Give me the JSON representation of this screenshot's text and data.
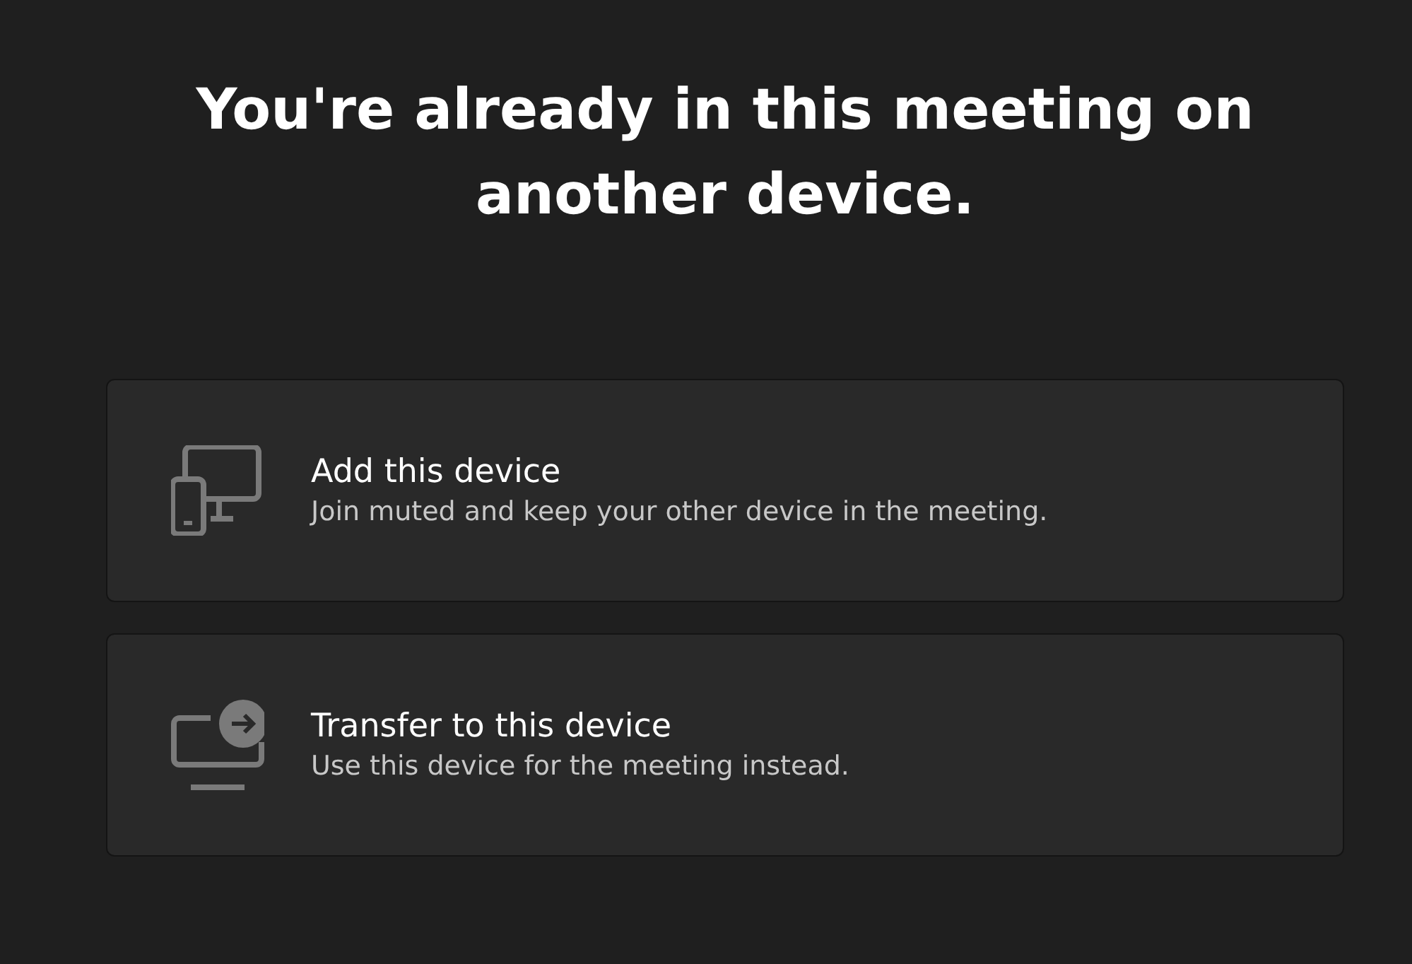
{
  "title": "You're already in this meeting on another device.",
  "options": [
    {
      "kind": "add",
      "label": "Add this device",
      "description": "Join muted and keep your other device in the meeting."
    },
    {
      "kind": "transfer",
      "label": "Transfer to this device",
      "description": "Use this device for the meeting instead."
    }
  ]
}
